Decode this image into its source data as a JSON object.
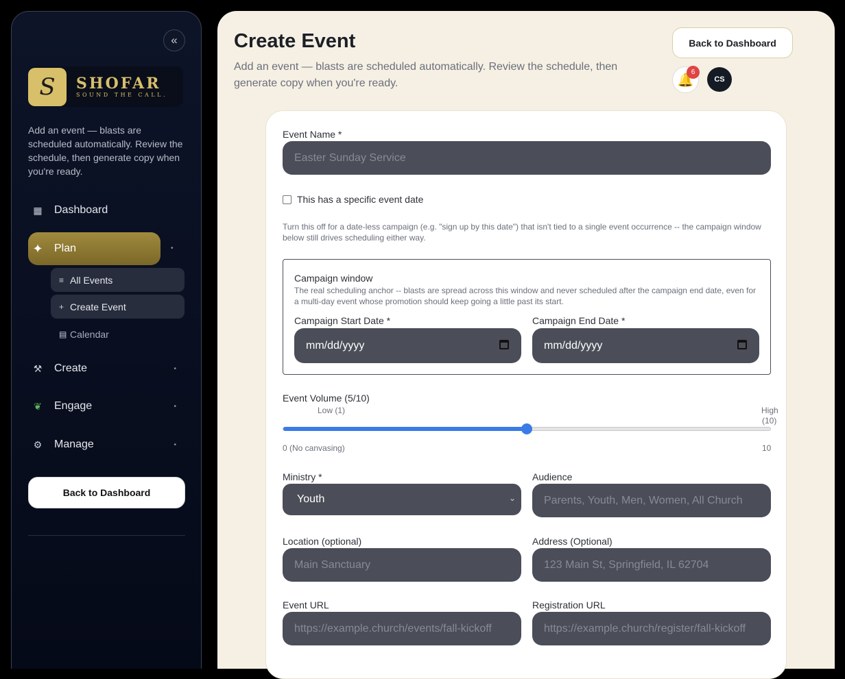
{
  "sidebar": {
    "collapse_glyph": "«",
    "logo": {
      "mark": "S",
      "title": "SHOFAR",
      "tagline": "SOUND THE CALL."
    },
    "description": "Add an event — blasts are scheduled automatically. Review the schedule, then generate copy when you're ready.",
    "nav": {
      "dashboard": {
        "label": "Dashboard",
        "icon": "grid-icon"
      },
      "plan": {
        "label": "Plan",
        "icon": "sparkle-icon"
      },
      "create": {
        "label": "Create",
        "icon": "hammer-icon"
      },
      "engage": {
        "label": "Engage",
        "icon": "seedling-icon"
      },
      "manage": {
        "label": "Manage",
        "icon": "gear-icon"
      }
    },
    "plan_subitems": {
      "all_events": "All Events",
      "create_event": "Create Event",
      "calendar": "Calendar"
    },
    "back_button": "Back to Dashboard"
  },
  "header": {
    "title": "Create Event",
    "subtitle": "Add an event — blasts are scheduled automatically. Review the schedule, then generate copy when you're ready.",
    "back_button": "Back to Dashboard",
    "notification_count": "6",
    "avatar_initials": "CS"
  },
  "form": {
    "event_name": {
      "label": "Event Name *",
      "placeholder": "Easter Sunday Service"
    },
    "specific_date": {
      "label": "This has a specific event date",
      "checked": false
    },
    "specific_date_help": "Turn this off for a date-less campaign (e.g. \"sign up by this date\") that isn't tied to a single event occurrence -- the campaign window below still drives scheduling either way.",
    "campaign": {
      "title": "Campaign window",
      "help": "The real scheduling anchor -- blasts are spread across this window and never scheduled after the campaign end date, even for a multi-day event whose promotion should keep going a little past its start.",
      "start": {
        "label": "Campaign Start Date *",
        "value": "mm/dd/yyyy"
      },
      "end": {
        "label": "Campaign End Date *",
        "value": "mm/dd/yyyy"
      }
    },
    "volume": {
      "label": "Event Volume (5/10)",
      "value": 5,
      "min": 0,
      "max": 10,
      "low_label": "Low (1)",
      "high_label_1": "High",
      "high_label_2": "(10)",
      "min_label": "0 (No canvasing)",
      "max_label": "10"
    },
    "ministry": {
      "label": "Ministry *",
      "value": "Youth"
    },
    "audience": {
      "label": "Audience",
      "placeholder": "Parents, Youth, Men, Women, All Church"
    },
    "location": {
      "label": "Location (optional)",
      "placeholder": "Main Sanctuary"
    },
    "address": {
      "label": "Address (Optional)",
      "placeholder": "123 Main St, Springfield, IL 62704"
    },
    "event_url": {
      "label": "Event URL",
      "placeholder": "https://example.church/events/fall-kickoff"
    },
    "registration_url": {
      "label": "Registration URL",
      "placeholder": "https://example.church/register/fall-kickoff"
    }
  },
  "colors": {
    "accent_gold": "#a08a3e",
    "slider_blue": "#3a7be8",
    "sidebar_bg": "#0d1428",
    "main_bg": "#f6f0e4"
  }
}
